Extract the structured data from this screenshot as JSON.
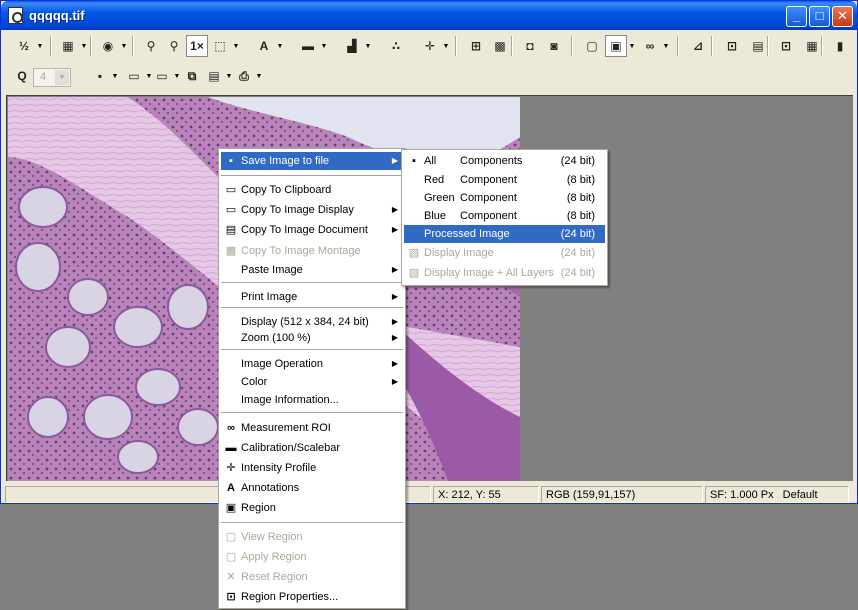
{
  "window": {
    "title": "qqqqq.tif",
    "minimize_glyph": "_",
    "maximize_glyph": "□",
    "close_glyph": "✕"
  },
  "toolbar1": {
    "tools": [
      {
        "name": "fit-scale-icon",
        "glyph": "½"
      },
      {
        "name": "image-bitmap-icon",
        "glyph": "▦"
      },
      {
        "name": "color-wheel-icon",
        "glyph": "◉"
      },
      {
        "name": "pin-icon",
        "glyph": "⚲"
      },
      {
        "name": "pin-2-icon",
        "glyph": "⚲"
      },
      {
        "name": "zoom-1x-icon",
        "glyph": "1×"
      },
      {
        "name": "selection-icon",
        "glyph": "⬚"
      },
      {
        "name": "text-icon",
        "glyph": "A"
      },
      {
        "name": "scalebar-icon",
        "glyph": "▬"
      },
      {
        "name": "histogram-icon",
        "glyph": "▟"
      },
      {
        "name": "particles-icon",
        "glyph": "∴"
      },
      {
        "name": "crosshair-icon",
        "glyph": "✛"
      },
      {
        "name": "stamp-icon",
        "glyph": "⊞"
      },
      {
        "name": "montage-icon",
        "glyph": "▩"
      },
      {
        "name": "rgb-icon",
        "glyph": "◘"
      },
      {
        "name": "rgb-2-icon",
        "glyph": "◙"
      },
      {
        "name": "region-icon",
        "glyph": "▢"
      },
      {
        "name": "region-pressed-icon",
        "glyph": "▣"
      },
      {
        "name": "measurement-icon",
        "glyph": "∞"
      },
      {
        "name": "calibrate-icon",
        "glyph": "⊿"
      },
      {
        "name": "properties-icon",
        "glyph": "⊡"
      },
      {
        "name": "palette-icon",
        "glyph": "▤"
      },
      {
        "name": "copy-props-icon",
        "glyph": "⊡"
      },
      {
        "name": "grid-icon",
        "glyph": "▦"
      },
      {
        "name": "extra-icon",
        "glyph": "▮"
      }
    ]
  },
  "toolbar2": {
    "tools": [
      {
        "name": "zoom-icon",
        "glyph": "Q"
      },
      {
        "name": "save-icon",
        "glyph": "▪"
      },
      {
        "name": "clipboard-icon",
        "glyph": "▭"
      },
      {
        "name": "monitor-icon",
        "glyph": "▭"
      },
      {
        "name": "copy-icon",
        "glyph": "⧉"
      },
      {
        "name": "document-icon",
        "glyph": "▤"
      },
      {
        "name": "print-icon",
        "glyph": "⎙"
      }
    ],
    "zoom_value": "4"
  },
  "status": {
    "coords": "X: 212, Y: 55",
    "rgb": "RGB (159,91,157)",
    "sf": "SF: 1.000 Px",
    "default": "Default"
  },
  "context_menu": {
    "items": [
      {
        "label": "Save Image to file",
        "icon": "floppy-icon",
        "glyph": "▪",
        "submenu": true,
        "highlight": true
      },
      {
        "label": "Copy To Clipboard",
        "icon": "clipboard-icon",
        "glyph": "▭"
      },
      {
        "label": "Copy To Image Display",
        "icon": "monitor-icon",
        "glyph": "▭",
        "submenu": true
      },
      {
        "label": "Copy To Image Document",
        "icon": "document-icon",
        "glyph": "▤",
        "submenu": true
      },
      {
        "label": "Copy To Image Montage",
        "icon": "montage-icon",
        "glyph": "▩",
        "disabled": true
      },
      {
        "label": "Paste Image",
        "submenu": true
      },
      {
        "label": "Print Image",
        "submenu": true
      },
      {
        "label": "Display (512 x 384, 24 bit)",
        "submenu": true
      },
      {
        "label": "Zoom (100 %)",
        "submenu": true
      },
      {
        "label": "Image Operation",
        "submenu": true
      },
      {
        "label": "Color",
        "submenu": true
      },
      {
        "label": "Image Information..."
      },
      {
        "label": "Measurement ROI",
        "icon": "measurement-icon",
        "glyph": "∞"
      },
      {
        "label": "Calibration/Scalebar",
        "icon": "scalebar-icon",
        "glyph": "▬"
      },
      {
        "label": "Intensity Profile",
        "icon": "crosshair-icon",
        "glyph": "✛"
      },
      {
        "label": "Annotations",
        "icon": "text-icon",
        "glyph": "A"
      },
      {
        "label": "Region",
        "icon": "region-icon",
        "glyph": "▣"
      },
      {
        "label": "View Region",
        "icon": "view-region-icon",
        "glyph": "▢",
        "disabled": true
      },
      {
        "label": "Apply Region",
        "icon": "apply-region-icon",
        "glyph": "▢",
        "disabled": true
      },
      {
        "label": "Reset Region",
        "icon": "reset-icon",
        "glyph": "✕",
        "disabled": true
      },
      {
        "label": "Region Properties...",
        "icon": "properties-icon",
        "glyph": "⊡"
      }
    ]
  },
  "save_submenu": {
    "items": [
      {
        "c1": "All",
        "c2": "Components",
        "bits": "(24 bit)",
        "icon": "floppy-icon",
        "glyph": "▪"
      },
      {
        "c1": "Red",
        "c2": "Component",
        "bits": "(8 bit)"
      },
      {
        "c1": "Green",
        "c2": "Component",
        "bits": "(8 bit)"
      },
      {
        "c1": "Blue",
        "c2": "Component",
        "bits": "(8 bit)"
      },
      {
        "c1": "Processed Image",
        "c2": "",
        "bits": "(24 bit)",
        "highlight": true
      },
      {
        "c1": "Display Image",
        "c2": "",
        "bits": "(24 bit)",
        "disabled": true,
        "icon": "display-icon",
        "glyph": "▧"
      },
      {
        "c1": "Display Image + All Layers",
        "c2": "",
        "bits": "(24 bit)",
        "disabled": true,
        "icon": "layers-icon",
        "glyph": "▧"
      }
    ]
  },
  "colors": {
    "titlebar": "#0058e6",
    "highlight": "#316ac5",
    "tissue": "#c8a0c8"
  }
}
